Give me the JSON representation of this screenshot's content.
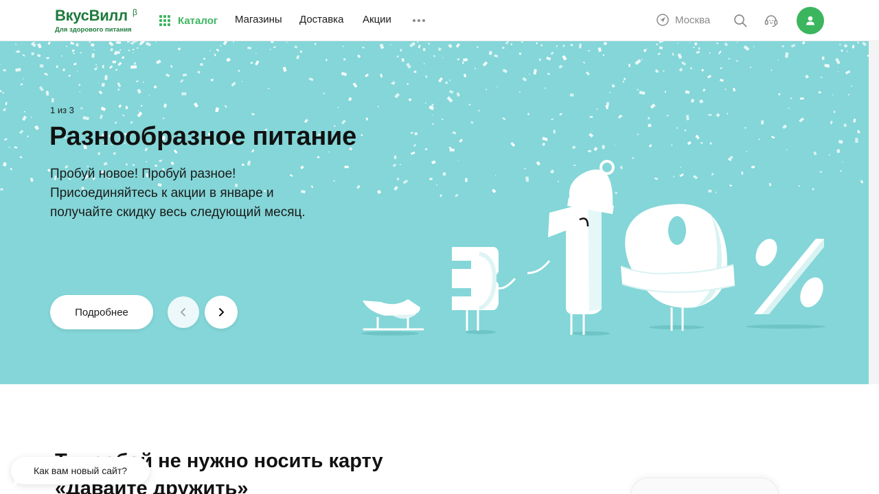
{
  "header": {
    "logo_text": "ВкусВилл",
    "logo_beta": "β",
    "logo_tagline": "Для здорового питания",
    "nav": {
      "catalog": "Каталог",
      "stores": "Магазины",
      "delivery": "Доставка",
      "promotions": "Акции",
      "more_icon": "more-dots-icon"
    },
    "city": "Москва",
    "icons": {
      "city": "location-arrow-icon",
      "search": "search-icon",
      "support": "support-headset-icon",
      "profile": "user-icon"
    }
  },
  "hero": {
    "counter": "1 из 3",
    "title": "Разнообразное питание",
    "text": "Пробуй новое! Пробуй разное! Присоединяйтесь к акции в январе и получайте скидку весь следующий месяц.",
    "button_label": "Подробнее",
    "prev_icon": "chevron-left-icon",
    "next_icon": "chevron-right-icon"
  },
  "section": {
    "title": "Т… собой не нужно носить карту «Давайте дружить»"
  },
  "feedback": {
    "label": "Как вам новый сайт?"
  },
  "colors": {
    "brand_green": "#3cb55f",
    "logo_green": "#1e7a3c",
    "hero_bg": "#84d6d8"
  }
}
